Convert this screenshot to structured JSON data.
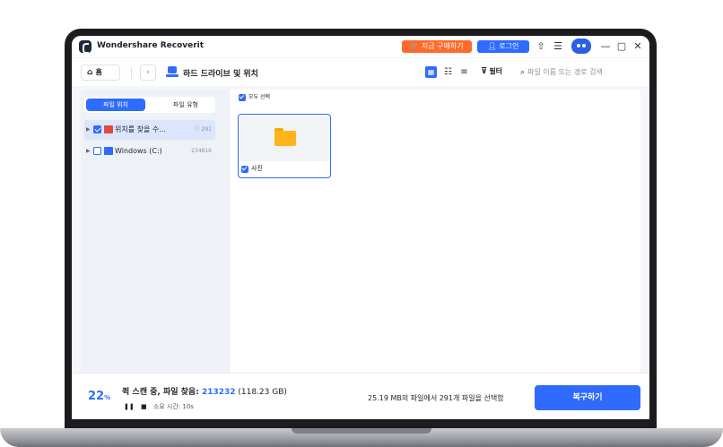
{
  "app": {
    "title": "Wondershare Recoverit",
    "buy_label": " 지금 구매하기",
    "login_label": "로그인"
  },
  "toolbar": {
    "home_label": "홈",
    "breadcrumb": "하드 드라이브 및 위치",
    "filter_label": "필터",
    "search_placeholder": "파일 이름 또는 경로 검색"
  },
  "sidebar": {
    "tabs": [
      "파일 위치",
      "파일 유형"
    ],
    "items": [
      {
        "label": "위치를 찾을 수...",
        "count": "291",
        "checked": true
      },
      {
        "label": "Windows (C:)",
        "count": "234816",
        "checked": false
      }
    ]
  },
  "main": {
    "select_all_label": "모두 선택",
    "cards": [
      {
        "name": "사진",
        "checked": true
      }
    ]
  },
  "bottom": {
    "progress": "22",
    "progress_unit": "%",
    "status_prefix": "퀵 스캔 중, 파일 찾음: ",
    "found_count": "213232",
    "found_size": " (118.23 GB)",
    "elapsed_label": "소요 시간: 10s",
    "selected_info": "25.19 MB의 파일에서 291개 파일을 선택함",
    "recover_label": "복구하기"
  },
  "colors": {
    "accent": "#2f6bff",
    "buy": "#ff6a2a",
    "folder": "#ffb41c"
  }
}
